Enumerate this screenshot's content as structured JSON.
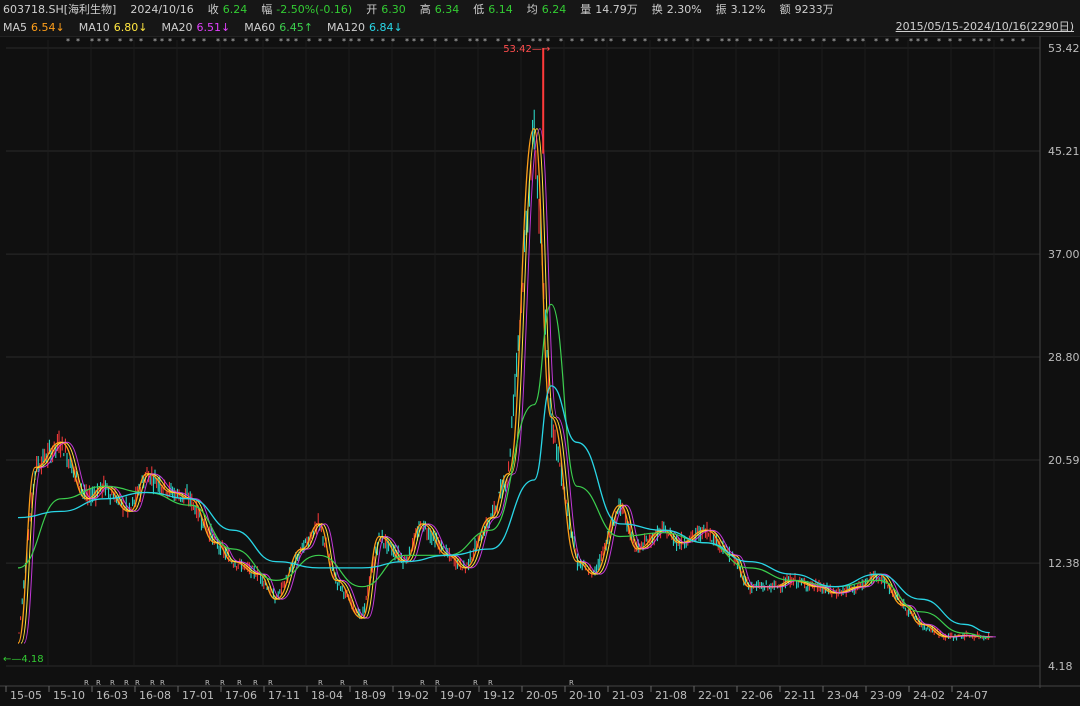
{
  "info": {
    "code": "603718.SH[海利生物]",
    "date": "2024/10/16",
    "close_label": "收",
    "close": "6.24",
    "change_label": "幅",
    "change": "-2.50%(-0.16)",
    "open_label": "开",
    "open": "6.30",
    "high_label": "高",
    "high": "6.34",
    "low_label": "低",
    "low": "6.14",
    "avg_label": "均",
    "avg": "6.24",
    "volume_label": "量",
    "volume": "14.79万",
    "turnover_label": "换",
    "turnover": "2.30%",
    "amplitude_label": "振",
    "amplitude": "3.12%",
    "amount_label": "额",
    "amount": "9233万"
  },
  "ma": [
    {
      "label": "MA5",
      "value": "6.54↓",
      "color": "#ff9f1a"
    },
    {
      "label": "MA10",
      "value": "6.80↓",
      "color": "#ffe640"
    },
    {
      "label": "MA20",
      "value": "6.51↓",
      "color": "#e040fb"
    },
    {
      "label": "MA60",
      "value": "6.45↑",
      "color": "#3ccf4e"
    },
    {
      "label": "MA120",
      "value": "6.84↓",
      "color": "#29d6e6"
    }
  ],
  "range_label": "2015/05/15-2024/10/16(2290日)",
  "colors": {
    "up": "#ff3a3a",
    "down": "#2ee6d6",
    "text_up": "#ff4d4d",
    "text_down": "#33cc33",
    "grid": "#2a2a2a"
  },
  "chart_data": {
    "type": "line",
    "y_ticks": [
      53.42,
      45.21,
      37.0,
      28.8,
      20.59,
      12.38,
      4.18
    ],
    "ylim": [
      4.18,
      53.42
    ],
    "y_scale": "linear",
    "x_ticks": [
      "15-05",
      "15-10",
      "16-03",
      "16-08",
      "17-01",
      "17-06",
      "17-11",
      "18-04",
      "18-09",
      "19-02",
      "19-07",
      "19-12",
      "20-05",
      "20-10",
      "21-03",
      "21-08",
      "22-01",
      "22-06",
      "22-11",
      "23-04",
      "23-09",
      "24-02",
      "24-07"
    ],
    "max_marker": {
      "label": "53.42",
      "x": "20-05",
      "value": 53.42
    },
    "min_marker": {
      "label": "4.18",
      "x": "15-05",
      "value": 4.18
    },
    "series": [
      {
        "name": "MA5",
        "color": "#ff9f1a",
        "x": [
          "15-05",
          "15-07",
          "15-10",
          "16-01",
          "16-03",
          "16-06",
          "16-08",
          "16-11",
          "17-01",
          "17-04",
          "17-06",
          "17-09",
          "17-11",
          "18-02",
          "18-04",
          "18-06",
          "18-09",
          "18-11",
          "19-02",
          "19-04",
          "19-07",
          "19-09",
          "19-12",
          "20-02",
          "20-05",
          "20-07",
          "20-10",
          "20-12",
          "21-03",
          "21-05",
          "21-08",
          "21-10",
          "22-01",
          "22-04",
          "22-06",
          "22-09",
          "22-11",
          "23-02",
          "23-04",
          "23-07",
          "23-09",
          "23-12",
          "24-02",
          "24-05",
          "24-07",
          "24-10"
        ],
        "values": [
          6.0,
          20.0,
          22.0,
          17.5,
          18.5,
          16.5,
          19.5,
          18.0,
          17.5,
          14.0,
          12.5,
          11.5,
          9.5,
          13.5,
          15.5,
          11.0,
          8.0,
          14.5,
          12.5,
          15.5,
          13.0,
          12.0,
          16.0,
          19.5,
          47.0,
          24.0,
          12.5,
          11.5,
          17.0,
          13.5,
          15.0,
          14.0,
          15.0,
          13.0,
          10.5,
          10.5,
          11.0,
          10.5,
          10.0,
          10.5,
          11.5,
          9.0,
          7.5,
          6.5,
          6.6,
          6.5
        ]
      },
      {
        "name": "MA60",
        "color": "#3ccf4e",
        "x": [
          "15-05",
          "15-10",
          "16-03",
          "16-08",
          "17-01",
          "17-06",
          "17-11",
          "18-04",
          "18-09",
          "19-02",
          "19-07",
          "19-12",
          "20-05",
          "20-07",
          "20-10",
          "21-03",
          "21-08",
          "22-01",
          "22-06",
          "22-11",
          "23-04",
          "23-09",
          "24-02",
          "24-07",
          "24-10"
        ],
        "values": [
          12.0,
          17.5,
          18.5,
          18.0,
          17.0,
          13.5,
          11.0,
          13.0,
          10.5,
          13.0,
          13.0,
          15.0,
          25.0,
          33.0,
          18.5,
          14.5,
          14.8,
          14.0,
          12.0,
          11.0,
          10.5,
          11.0,
          8.5,
          6.8,
          6.45
        ]
      },
      {
        "name": "MA120",
        "color": "#29d6e6",
        "x": [
          "15-05",
          "15-10",
          "16-03",
          "16-08",
          "17-01",
          "17-06",
          "17-11",
          "18-04",
          "18-09",
          "19-02",
          "19-07",
          "19-12",
          "20-05",
          "20-07",
          "20-10",
          "21-03",
          "21-08",
          "22-01",
          "22-06",
          "22-11",
          "23-04",
          "23-09",
          "24-02",
          "24-07",
          "24-10"
        ],
        "values": [
          16.0,
          16.5,
          17.5,
          18.0,
          17.5,
          15.0,
          12.5,
          12.0,
          12.0,
          12.5,
          13.0,
          13.5,
          19.0,
          26.5,
          22.0,
          15.5,
          15.0,
          14.0,
          12.5,
          11.5,
          10.5,
          11.5,
          9.5,
          7.5,
          6.84
        ]
      }
    ]
  }
}
